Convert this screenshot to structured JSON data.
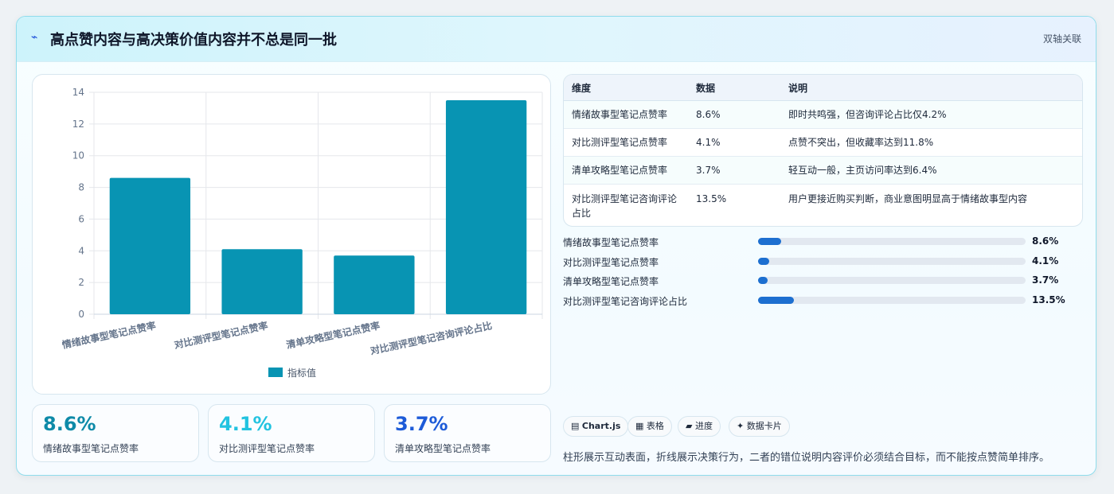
{
  "header": {
    "title": "高点赞内容与高决策价值内容并不总是同一批",
    "icon": "sparkle-icon",
    "tag": "双轴关联"
  },
  "colors": {
    "bar": "#0894b3",
    "kpi1": "#0e8aa8",
    "kpi2": "#22c3e0",
    "kpi3": "#1d5bd8",
    "progress": "#1d6fd0"
  },
  "chart_data": {
    "type": "bar",
    "categories": [
      "情绪故事型笔记点赞率",
      "对比测评型笔记点赞率",
      "清单攻略型笔记点赞率",
      "对比测评型笔记咨询评论占比"
    ],
    "series": [
      {
        "name": "指标值",
        "values": [
          8.6,
          4.1,
          3.7,
          13.5
        ]
      }
    ],
    "ylim": [
      0,
      14
    ],
    "yticks": [
      0,
      2,
      4,
      6,
      8,
      10,
      12,
      14
    ],
    "grid": true,
    "legend": "bottom"
  },
  "kpis": [
    {
      "value": "8.6%",
      "label": "情绪故事型笔记点赞率"
    },
    {
      "value": "4.1%",
      "label": "对比测评型笔记点赞率"
    },
    {
      "value": "3.7%",
      "label": "清单攻略型笔记点赞率"
    }
  ],
  "table": {
    "headers": [
      "维度",
      "数据",
      "说明"
    ],
    "rows": [
      [
        "情绪故事型笔记点赞率",
        "8.6%",
        "即时共鸣强，但咨询评论占比仅4.2%"
      ],
      [
        "对比测评型笔记点赞率",
        "4.1%",
        "点赞不突出，但收藏率达到11.8%"
      ],
      [
        "清单攻略型笔记点赞率",
        "3.7%",
        "轻互动一般，主页访问率达到6.4%"
      ],
      [
        "对比测评型笔记咨询评论占比",
        "13.5%",
        "用户更接近购买判断，商业意图明显高于情绪故事型内容"
      ]
    ]
  },
  "progress": {
    "max": 100,
    "items": [
      {
        "label": "情绪故事型笔记点赞率",
        "value": 8.6,
        "text": "8.6%"
      },
      {
        "label": "对比测评型笔记点赞率",
        "value": 4.1,
        "text": "4.1%"
      },
      {
        "label": "清单攻略型笔记点赞率",
        "value": 3.7,
        "text": "3.7%"
      },
      {
        "label": "对比测评型笔记咨询评论占比",
        "value": 13.5,
        "text": "13.5%"
      }
    ]
  },
  "chips": [
    {
      "icon": "▤",
      "label": "Chart.js",
      "bold": true
    },
    {
      "icon": "▦",
      "label": "表格",
      "bold": false
    },
    {
      "icon": "▰",
      "label": "进度",
      "bold": false
    },
    {
      "icon": "✦",
      "label": "数据卡片",
      "bold": false
    }
  ],
  "note": "柱形展示互动表面，折线展示决策行为，二者的错位说明内容评价必须结合目标，而不能按点赞简单排序。"
}
